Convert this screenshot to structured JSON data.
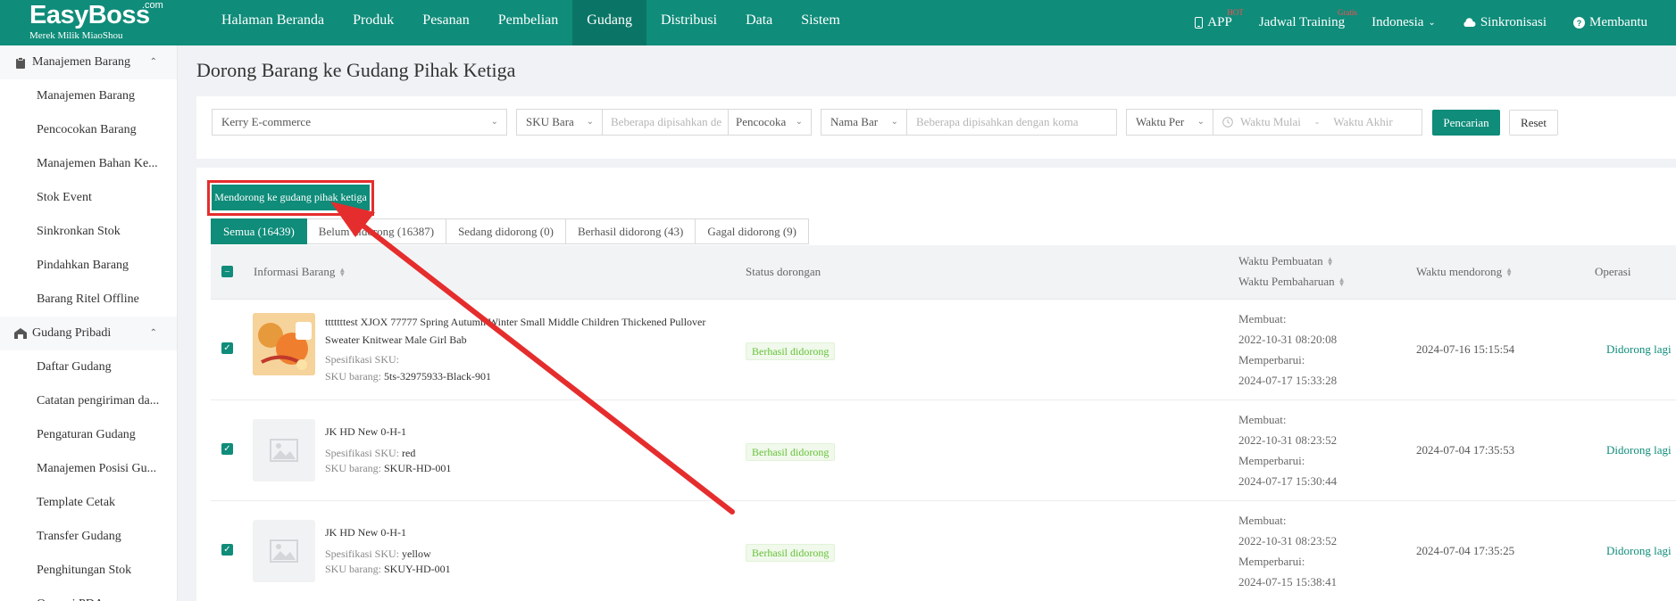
{
  "header": {
    "brand": "EasyBoss",
    "brand_suffix": ".com",
    "tagline": "Merek Milik MiaoShou",
    "nav": [
      "Halaman Beranda",
      "Produk",
      "Pesanan",
      "Pembelian",
      "Gudang",
      "Distribusi",
      "Data",
      "Sistem"
    ],
    "active_nav": "Gudang",
    "app_label": "APP",
    "app_badge": "HOT",
    "training_label": "Jadwal Training",
    "training_badge": "Gratis",
    "language": "Indonesia",
    "sync_label": "Sinkronisasi",
    "help_label": "Membantu"
  },
  "sidebar": {
    "group1": "Manajemen Barang",
    "group1_items": [
      "Manajemen Barang",
      "Pencocokan Barang",
      "Manajemen Bahan Ke...",
      "Stok Event",
      "Sinkronkan Stok",
      "Pindahkan Barang",
      "Barang Ritel Offline"
    ],
    "group2": "Gudang Pribadi",
    "group2_items": [
      "Daftar Gudang",
      "Catatan pengiriman da...",
      "Pengaturan Gudang",
      "Manajemen Posisi Gu...",
      "Template Cetak",
      "Transfer Gudang",
      "Penghitungan Stok",
      "Operasi PDA"
    ]
  },
  "page": {
    "title": "Dorong Barang ke Gudang Pihak Ketiga"
  },
  "filters": {
    "warehouse": "Kerry E-commerce",
    "sku_type": "SKU Bara",
    "sku_placeholder": "Beberapa dipisahkan de",
    "match_mode": "Pencocoka",
    "name_type": "Nama Bar",
    "name_placeholder": "Beberapa dipisahkan dengan koma",
    "time_type": "Waktu Per",
    "start_placeholder": "Waktu Mulai",
    "range_sep": "-",
    "end_placeholder": "Waktu Akhir",
    "search_label": "Pencarian",
    "reset_label": "Reset"
  },
  "actions": {
    "push_label": "Mendorong ke gudang pihak ketiga"
  },
  "tabs": [
    "Semua (16439)",
    "Belum didorong (16387)",
    "Sedang didorong (0)",
    "Berhasil didorong (43)",
    "Gagal didorong (9)"
  ],
  "table": {
    "col_info": "Informasi Barang",
    "col_status": "Status dorongan",
    "col_created": "Waktu Pembuatan",
    "col_updated": "Waktu Pembaharuan",
    "col_push_time": "Waktu mendorong",
    "col_operation": "Operasi",
    "label_spec": "Spesifikasi SKU:",
    "label_sku": "SKU barang:",
    "label_created": "Membuat:",
    "label_updated": "Memperbarui:",
    "rows": [
      {
        "title": "tttttttest XJOX 77777 Spring Autumn Winter Small Middle Children Thickened Pullover Sweater Knitwear Male Girl Bab",
        "spec": "",
        "sku": "5ts-32975933-Black-901",
        "status": "Berhasil didorong",
        "created": "2022-10-31 08:20:08",
        "updated": "2024-07-17 15:33:28",
        "push_time": "2024-07-16 15:15:54",
        "op": "Didorong lagi"
      },
      {
        "title": "JK HD New 0-H-1",
        "spec": "red",
        "sku": "SKUR-HD-001",
        "status": "Berhasil didorong",
        "created": "2022-10-31 08:23:52",
        "updated": "2024-07-17 15:30:44",
        "push_time": "2024-07-04 17:35:53",
        "op": "Didorong lagi"
      },
      {
        "title": "JK HD New 0-H-1",
        "spec": "yellow",
        "sku": "SKUY-HD-001",
        "status": "Berhasil didorong",
        "created": "2022-10-31 08:23:52",
        "updated": "2024-07-15 15:38:41",
        "push_time": "2024-07-04 17:35:25",
        "op": "Didorong lagi"
      }
    ]
  },
  "colors": {
    "primary": "#0f8c7a",
    "annotation": "#e52d2d",
    "success": "#67c23a"
  }
}
